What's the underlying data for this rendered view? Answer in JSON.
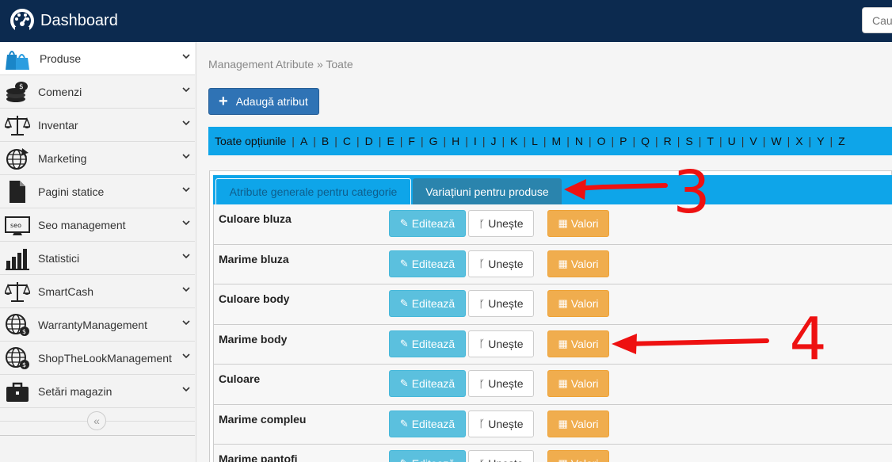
{
  "header": {
    "title": "Dashboard",
    "logo_icon": "dashboard-gauge-icon",
    "search_placeholder": "Caut"
  },
  "sidebar": {
    "items": [
      {
        "label": "Produse",
        "icon": "shopping-bags-icon",
        "active": true
      },
      {
        "label": "Comenzi",
        "icon": "coins-icon"
      },
      {
        "label": "Inventar",
        "icon": "scale-icon"
      },
      {
        "label": "Marketing",
        "icon": "globe-cursor-icon"
      },
      {
        "label": "Pagini statice",
        "icon": "document-icon"
      },
      {
        "label": "Seo management",
        "icon": "seo-monitor-icon"
      },
      {
        "label": "Statistici",
        "icon": "bar-chart-icon"
      },
      {
        "label": "SmartCash",
        "icon": "scale-icon"
      },
      {
        "label": "WarrantyManagement",
        "icon": "globe-dollar-icon"
      },
      {
        "label": "ShopTheLookManagement",
        "icon": "globe-dollar-icon"
      },
      {
        "label": "Setări magazin",
        "icon": "briefcase-icon"
      }
    ],
    "collapse_icon": "double-chevron-left-icon"
  },
  "main": {
    "breadcrumb": "Management Atribute » Toate",
    "add_button": "Adaugă atribut",
    "alphabet_all": "Toate opțiunile",
    "alphabet": [
      "A",
      "B",
      "C",
      "D",
      "E",
      "F",
      "G",
      "H",
      "I",
      "J",
      "K",
      "L",
      "M",
      "N",
      "O",
      "P",
      "Q",
      "R",
      "S",
      "T",
      "U",
      "V",
      "W",
      "X",
      "Y",
      "Z"
    ],
    "tabs": [
      {
        "label": "Atribute generale pentru categorie"
      },
      {
        "label": "Variațiuni pentru produse",
        "active": true
      }
    ],
    "buttons": {
      "edit": "Editează",
      "merge": "Unește",
      "values": "Valori"
    },
    "attributes": [
      {
        "name": "Culoare bluza"
      },
      {
        "name": "Marime bluza"
      },
      {
        "name": "Culoare body"
      },
      {
        "name": "Marime body"
      },
      {
        "name": "Culoare"
      },
      {
        "name": "Marime compleu"
      },
      {
        "name": "Marime pantofi"
      }
    ]
  },
  "annotations": [
    {
      "label": "3",
      "color": "#ee1111"
    },
    {
      "label": "4",
      "color": "#ee1111"
    }
  ]
}
